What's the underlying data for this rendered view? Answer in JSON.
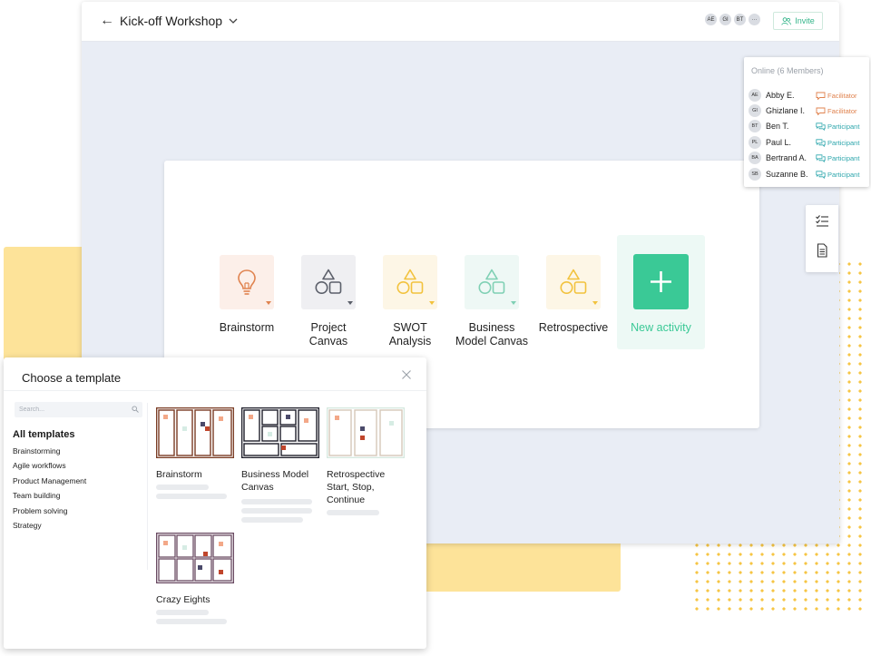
{
  "board": {
    "title": "Kick-off Workshop",
    "back_icon": "arrow-left-icon",
    "avatars": [
      "AE",
      "GI",
      "BT",
      "···"
    ],
    "invite_label": "Invite"
  },
  "members": {
    "title": "Online (6 Members)",
    "list": [
      {
        "initials": "AE",
        "name": "Abby E.",
        "role": "Facilitator",
        "kind": "fac"
      },
      {
        "initials": "GI",
        "name": "Ghizlane I.",
        "role": "Facilitator",
        "kind": "fac"
      },
      {
        "initials": "BT",
        "name": "Ben T.",
        "role": "Participant",
        "kind": "par"
      },
      {
        "initials": "PL",
        "name": "Paul L.",
        "role": "Participant",
        "kind": "par"
      },
      {
        "initials": "BA",
        "name": "Bertrand A.",
        "role": "Participant",
        "kind": "par"
      },
      {
        "initials": "SB",
        "name": "Suzanne B.",
        "role": "Participant",
        "kind": "par"
      }
    ]
  },
  "activities": [
    {
      "label": "Brainstorm",
      "icon": "lightbulb-icon",
      "tile_color": "#fcefe9"
    },
    {
      "label": "Project Canvas",
      "icon": "shapes-icon",
      "tile_color": "#efeff2"
    },
    {
      "label": "SWOT Analysis",
      "icon": "shapes-icon",
      "tile_color": "#fdf6e6"
    },
    {
      "label": "Business Model Canvas",
      "icon": "shapes-icon",
      "tile_color": "#eef8f5"
    },
    {
      "label": "Retrospective",
      "icon": "shapes-icon",
      "tile_color": "#fdf6e6"
    }
  ],
  "new_activity_label": "New activity",
  "template_modal": {
    "title": "Choose a template",
    "search_placeholder": "Search...",
    "categories_heading": "All templates",
    "categories": [
      "Brainstorming",
      "Agile workflows",
      "Product Management",
      "Team building",
      "Problem solving",
      "Strategy"
    ],
    "templates": [
      {
        "name": "Brainstorm"
      },
      {
        "name": "Business Model Canvas"
      },
      {
        "name": "Retrospective Start, Stop, Continue"
      },
      {
        "name": "Crazy Eights"
      }
    ]
  },
  "colors": {
    "accent_green": "#3ac996",
    "facilitator": "#e0834f",
    "participant": "#2fa7ad",
    "highlight_yellow": "#fde399"
  }
}
